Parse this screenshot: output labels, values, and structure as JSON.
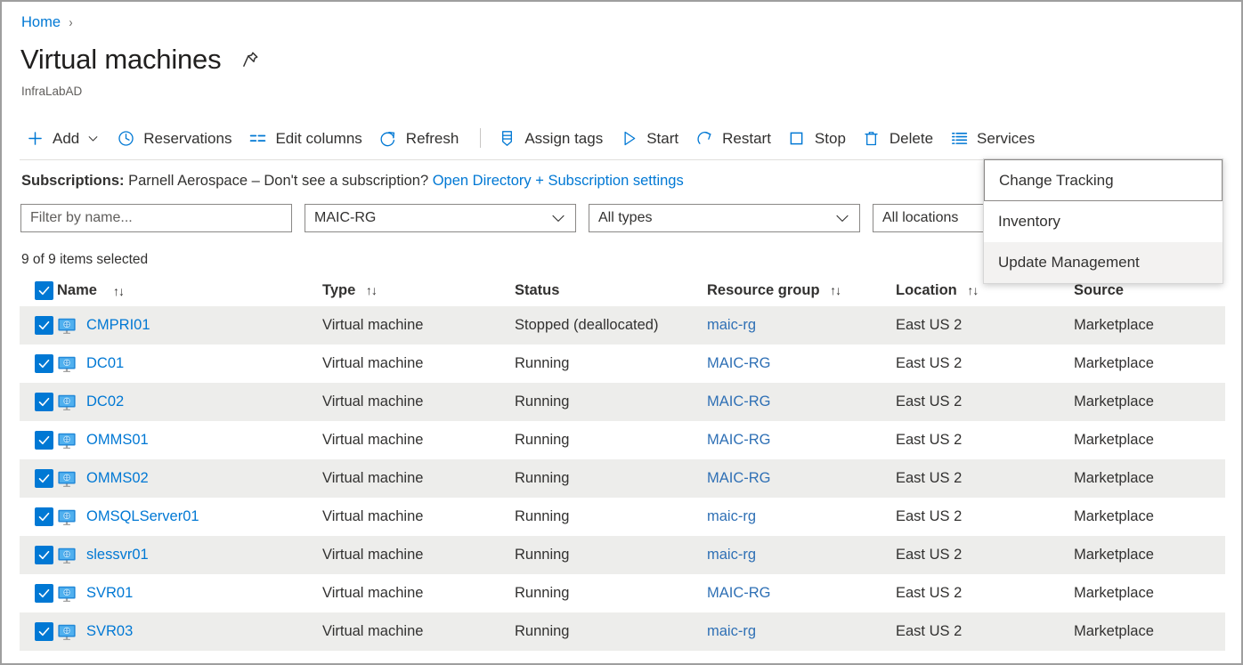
{
  "breadcrumb": {
    "home": "Home",
    "separator": "›"
  },
  "header": {
    "title": "Virtual machines",
    "subtitle": "InfraLabAD",
    "pin_icon": "pin-icon"
  },
  "toolbar": {
    "items": [
      {
        "label": "Add",
        "icon": "plus-icon",
        "has_chevron": true
      },
      {
        "label": "Reservations",
        "icon": "clock-icon",
        "has_chevron": false
      },
      {
        "label": "Edit columns",
        "icon": "columns-icon",
        "has_chevron": false
      },
      {
        "label": "Refresh",
        "icon": "refresh-icon",
        "has_chevron": false
      },
      {
        "label": "Assign tags",
        "icon": "tag-icon",
        "has_chevron": false
      },
      {
        "label": "Start",
        "icon": "play-icon",
        "has_chevron": false
      },
      {
        "label": "Restart",
        "icon": "restart-icon",
        "has_chevron": false
      },
      {
        "label": "Stop",
        "icon": "stop-icon",
        "has_chevron": false
      },
      {
        "label": "Delete",
        "icon": "trash-icon",
        "has_chevron": false
      },
      {
        "label": "Services",
        "icon": "services-list-icon",
        "has_chevron": false
      }
    ]
  },
  "subscriptions": {
    "label": "Subscriptions:",
    "value": " Parnell Aerospace – Don't see a subscription? ",
    "link": "Open Directory + Subscription settings"
  },
  "filters": {
    "name_placeholder": "Filter by name...",
    "resource_group": "MAIC-RG",
    "type": "All types",
    "location": "All locations",
    "chevron_icon": "chevron-down-icon"
  },
  "selection_text": "9 of 9 items selected",
  "table": {
    "columns": [
      {
        "label": "Name",
        "sortable": true
      },
      {
        "label": "Type",
        "sortable": true
      },
      {
        "label": "Status",
        "sortable": false
      },
      {
        "label": "Resource group",
        "sortable": true
      },
      {
        "label": "Location",
        "sortable": true
      },
      {
        "label": "Source",
        "sortable": false
      }
    ],
    "sort_glyph": "↑↓",
    "rows": [
      {
        "checked": true,
        "name": "CMPRI01",
        "type": "Virtual machine",
        "status": "Stopped (deallocated)",
        "resource_group": "maic-rg",
        "location": "East US 2",
        "source": "Marketplace"
      },
      {
        "checked": true,
        "name": "DC01",
        "type": "Virtual machine",
        "status": "Running",
        "resource_group": "MAIC-RG",
        "location": "East US 2",
        "source": "Marketplace"
      },
      {
        "checked": true,
        "name": "DC02",
        "type": "Virtual machine",
        "status": "Running",
        "resource_group": "MAIC-RG",
        "location": "East US 2",
        "source": "Marketplace"
      },
      {
        "checked": true,
        "name": "OMMS01",
        "type": "Virtual machine",
        "status": "Running",
        "resource_group": "MAIC-RG",
        "location": "East US 2",
        "source": "Marketplace"
      },
      {
        "checked": true,
        "name": "OMMS02",
        "type": "Virtual machine",
        "status": "Running",
        "resource_group": "MAIC-RG",
        "location": "East US 2",
        "source": "Marketplace"
      },
      {
        "checked": true,
        "name": "OMSQLServer01",
        "type": "Virtual machine",
        "status": "Running",
        "resource_group": "maic-rg",
        "location": "East US 2",
        "source": "Marketplace"
      },
      {
        "checked": true,
        "name": "slessvr01",
        "type": "Virtual machine",
        "status": "Running",
        "resource_group": "maic-rg",
        "location": "East US 2",
        "source": "Marketplace"
      },
      {
        "checked": true,
        "name": "SVR01",
        "type": "Virtual machine",
        "status": "Running",
        "resource_group": "MAIC-RG",
        "location": "East US 2",
        "source": "Marketplace"
      },
      {
        "checked": true,
        "name": "SVR03",
        "type": "Virtual machine",
        "status": "Running",
        "resource_group": "maic-rg",
        "location": "East US 2",
        "source": "Marketplace"
      }
    ]
  },
  "services_menu": {
    "items": [
      {
        "label": "Change Tracking",
        "state": "focused"
      },
      {
        "label": "Inventory",
        "state": "normal"
      },
      {
        "label": "Update Management",
        "state": "hovered"
      }
    ]
  },
  "colors": {
    "accent": "#0078d4",
    "link": "#0078d4",
    "rg_link": "#2f70b5",
    "row_alt": "#ededeb",
    "text": "#323130",
    "muted": "#605e5c",
    "border": "#8a8886"
  }
}
